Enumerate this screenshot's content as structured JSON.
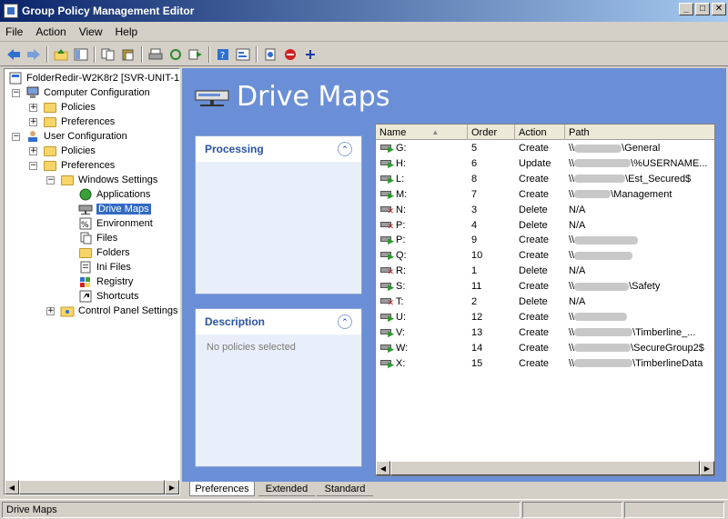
{
  "window": {
    "title": "Group Policy Management Editor",
    "min": "_",
    "max": "□",
    "close": "✕"
  },
  "menu": [
    "File",
    "Action",
    "View",
    "Help"
  ],
  "tree": {
    "root": "FolderRedir-W2K8r2 [SVR-UNIT-1.",
    "computer_config": "Computer Configuration",
    "policies": "Policies",
    "preferences": "Preferences",
    "user_config": "User Configuration",
    "windows_settings": "Windows Settings",
    "applications": "Applications",
    "drive_maps": "Drive Maps",
    "environment": "Environment",
    "files": "Files",
    "folders": "Folders",
    "ini_files": "Ini Files",
    "registry": "Registry",
    "shortcuts": "Shortcuts",
    "control_panel": "Control Panel Settings"
  },
  "main": {
    "title": "Drive Maps",
    "processing": "Processing",
    "description": "Description",
    "description_text": "No policies selected"
  },
  "columns": [
    "Name",
    "Order",
    "Action",
    "Path"
  ],
  "rows": [
    {
      "name": "G:",
      "order": "5",
      "action": "Create",
      "path_prefix": "\\\\",
      "path_suffix": "\\General"
    },
    {
      "name": "H:",
      "order": "6",
      "action": "Update",
      "path_prefix": "\\\\",
      "path_suffix": "\\%USERNAME..."
    },
    {
      "name": "L:",
      "order": "8",
      "action": "Create",
      "path_prefix": "\\\\",
      "path_suffix": "\\Est_Secured$"
    },
    {
      "name": "M:",
      "order": "7",
      "action": "Create",
      "path_prefix": "\\\\",
      "path_suffix": "\\Management"
    },
    {
      "name": "N:",
      "order": "3",
      "action": "Delete",
      "path_prefix": "N/A",
      "path_suffix": ""
    },
    {
      "name": "P:",
      "order": "4",
      "action": "Delete",
      "path_prefix": "N/A",
      "path_suffix": ""
    },
    {
      "name": "P:",
      "order": "9",
      "action": "Create",
      "path_prefix": "\\\\",
      "path_suffix": ""
    },
    {
      "name": "Q:",
      "order": "10",
      "action": "Create",
      "path_prefix": "\\\\",
      "path_suffix": ""
    },
    {
      "name": "R:",
      "order": "1",
      "action": "Delete",
      "path_prefix": "N/A",
      "path_suffix": ""
    },
    {
      "name": "S:",
      "order": "11",
      "action": "Create",
      "path_prefix": "\\\\",
      "path_suffix": "\\Safety"
    },
    {
      "name": "T:",
      "order": "2",
      "action": "Delete",
      "path_prefix": "N/A",
      "path_suffix": ""
    },
    {
      "name": "U:",
      "order": "12",
      "action": "Create",
      "path_prefix": "\\\\",
      "path_suffix": ""
    },
    {
      "name": "V:",
      "order": "13",
      "action": "Create",
      "path_prefix": "\\\\",
      "path_suffix": "\\Timberline_..."
    },
    {
      "name": "W:",
      "order": "14",
      "action": "Create",
      "path_prefix": "\\\\",
      "path_suffix": "\\SecureGroup2$"
    },
    {
      "name": "X:",
      "order": "15",
      "action": "Create",
      "path_prefix": "\\\\",
      "path_suffix": "\\TimberlineData"
    }
  ],
  "tabs": [
    "Preferences",
    "Extended",
    "Standard"
  ],
  "status": "Drive Maps"
}
